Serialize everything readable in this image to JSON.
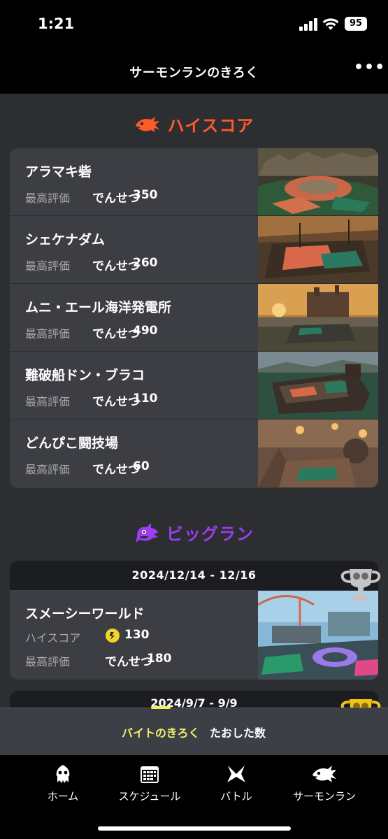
{
  "status": {
    "time": "1:21",
    "battery": "95"
  },
  "header": {
    "title": "サーモンランのきろく",
    "more": "•••"
  },
  "highscore": {
    "title": "ハイスコア",
    "label": "最高評価",
    "stages": [
      {
        "name": "アラマキ砦",
        "rank": "でんせつ",
        "score": "350"
      },
      {
        "name": "シェケナダム",
        "rank": "でんせつ",
        "score": "260"
      },
      {
        "name": "ムニ・エール海洋発電所",
        "rank": "でんせつ",
        "score": "490"
      },
      {
        "name": "難破船ドン・ブラコ",
        "rank": "でんせつ",
        "score": "110"
      },
      {
        "name": "どんぴこ闘技場",
        "rank": "でんせつ",
        "score": "60"
      }
    ]
  },
  "bigrun": {
    "title": "ビッグラン",
    "entries": [
      {
        "date": "2024/12/14 - 12/16",
        "stage": "スメーシーワールド",
        "highscore_label": "ハイスコア",
        "highscore": "130",
        "best_label": "最高評価",
        "rank": "でんせつ",
        "rank_score": "180",
        "trophy": "silver"
      },
      {
        "date": "2024/9/7 - 9/9",
        "trophy": "gold"
      }
    ]
  },
  "tabs": {
    "items": [
      "バイトのきろく",
      "たおした数"
    ],
    "active": 0
  },
  "nav": {
    "items": [
      "ホーム",
      "スケジュール",
      "バトル",
      "サーモンラン"
    ]
  },
  "colors": {
    "accent_orange": "#ff5a2a",
    "accent_purple": "#9b3df0",
    "active_tab": "#eef06a"
  }
}
